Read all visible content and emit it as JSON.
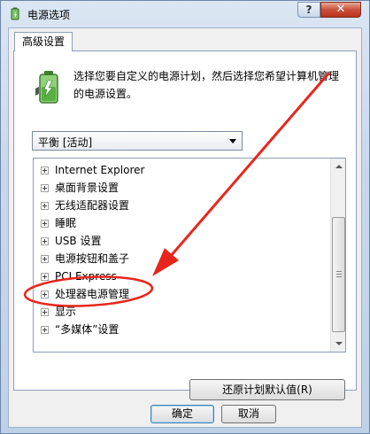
{
  "window": {
    "title": "电源选项",
    "help_label": "?",
    "close_label": "✕"
  },
  "tab": {
    "label": "高级设置"
  },
  "description": "选择您要自定义的电源计划，然后选择您希望计算机管理的电源设置。",
  "plan_select": {
    "value": "平衡 [活动]"
  },
  "tree_items": [
    "Internet Explorer",
    "桌面背景设置",
    "无线适配器设置",
    "睡眠",
    "USB 设置",
    "电源按钮和盖子",
    "PCI Express",
    "处理器电源管理",
    "显示",
    "“多媒体”设置"
  ],
  "buttons": {
    "restore": "还原计划默认值(R)",
    "ok": "确定",
    "cancel": "取消"
  },
  "colors": {
    "annotation": "#e8261d",
    "title_close": "#c9503a"
  },
  "icons": {
    "title": "battery-power-icon",
    "settings": "battery-power-icon"
  }
}
